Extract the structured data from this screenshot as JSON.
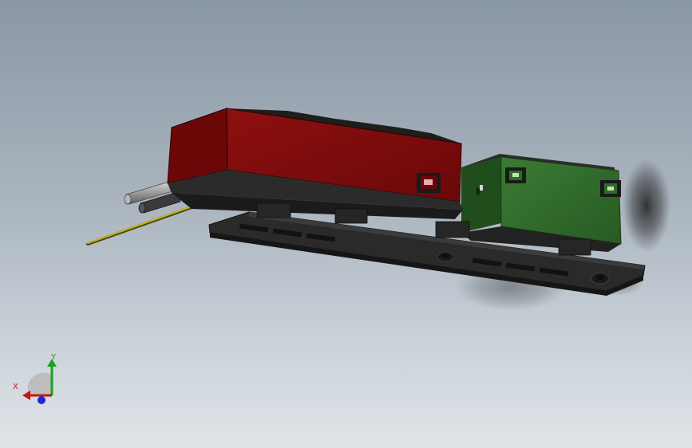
{
  "viewport": {
    "background_top": "#8a97a5",
    "background_bottom": "#dfe4e8"
  },
  "model": {
    "red_enclosure_color": "#7e0b0b",
    "green_enclosure_color": "#2f6a2a",
    "bracket_color": "#2b2b2b",
    "wire_color": "#b0a21a",
    "rod_color": "#9a9a9a"
  },
  "triad": {
    "x_label": "X",
    "y_label": "Y",
    "x_color": "#c81414",
    "y_color": "#1aa31a",
    "z_color": "#1a2ad0"
  }
}
